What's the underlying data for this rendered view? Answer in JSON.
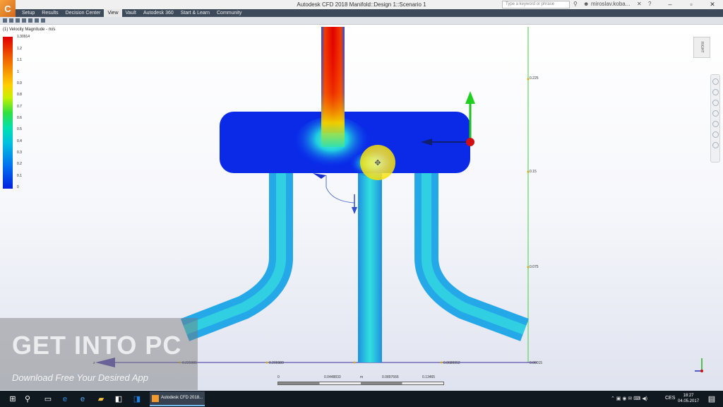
{
  "window": {
    "title": "Autodesk CFD 2018   Manifold::Design 1::Scenario 1",
    "search_placeholder": "Type a keyword or phrase",
    "user": "miroslav.koba...",
    "logo": "C"
  },
  "menu": [
    "Setup",
    "Results",
    "Decision Center",
    "View",
    "Vault",
    "Autodesk 360",
    "Start & Learn",
    "Community"
  ],
  "menu_active": "View",
  "legend": {
    "title": "(1) Velocity Magnitude - m/s",
    "max": "1.30914",
    "ticks": [
      "1.2",
      "1.1",
      "1",
      "0.9",
      "0.8",
      "0.7",
      "0.6",
      "0.5",
      "0.4",
      "0.3",
      "0.2",
      "0.1",
      "0"
    ]
  },
  "viewcube_label": "RIGHT",
  "y_axis_ticks": [
    "0.225",
    "0.15",
    "0.075"
  ],
  "x_axis_ticks": [
    "0.225985",
    "0.206989",
    "0.0689952",
    "0.00015"
  ],
  "x_axis_label": "z",
  "scale_bar": {
    "ticks": [
      "0",
      "0.0448833",
      "m",
      "0.0897666",
      "0.13465"
    ]
  },
  "watermark": {
    "title": "GET INTO PC",
    "subtitle": "Download Free Your Desired App"
  },
  "taskbar": {
    "app_label": "Autodesk CFD 2018...",
    "language": "CES",
    "time": "18:27",
    "date": "04.05.2017"
  }
}
